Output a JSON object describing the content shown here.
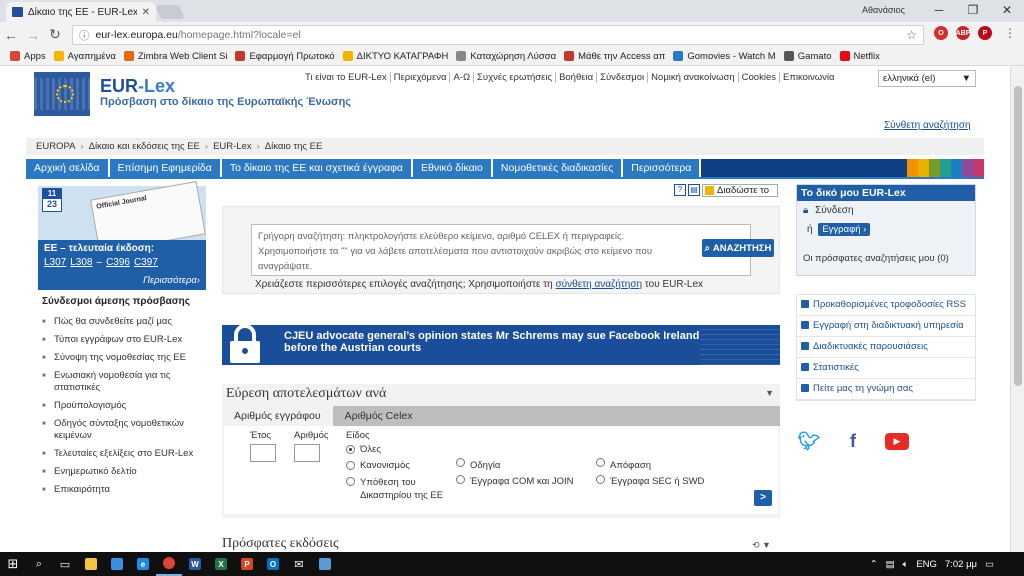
{
  "browser": {
    "tab_title": "Δίκαιο της ΕΕ - EUR-Lex",
    "user": "Αθανάσιος",
    "url_host": "eur-lex.europa.eu",
    "url_path": "/homepage.html?locale=el",
    "bookmarks": [
      {
        "label": "Apps",
        "color": "#d14836"
      },
      {
        "label": "Αγαπημένα",
        "color": "#f5b400"
      },
      {
        "label": "Zimbra Web Client Si",
        "color": "#e36c0a"
      },
      {
        "label": "Εφαρμογή Πρωτοκό",
        "color": "#c0392b"
      },
      {
        "label": "ΔΙΚΤΥΟ ΚΑΤΑΓΡΑΦΗ",
        "color": "#f5b400"
      },
      {
        "label": "Καταχώρηση Λύσσα",
        "color": "#888888"
      },
      {
        "label": "Μάθε την Access απ",
        "color": "#c0392b"
      },
      {
        "label": "Gomovies - Watch M",
        "color": "#2b79c2"
      },
      {
        "label": "Gamato",
        "color": "#555555"
      },
      {
        "label": "Netflix",
        "color": "#e50914"
      }
    ]
  },
  "header": {
    "brand_eur": "EUR",
    "brand_lex": "-Lex",
    "tagline": "Πρόσβαση στο δίκαιο της Ευρωπαϊκής Ένωσης",
    "toplinks": [
      "Τι είναι το EUR-Lex",
      "Περιεχόμενα",
      "Α-Ω",
      "Συχνές ερωτήσεις",
      "Βοήθεια",
      "Σύνδεσμοι",
      "Νομική ανακοίνωση",
      "Cookies",
      "Επικοινωνία"
    ],
    "language": "ελληνικά (el)",
    "advanced_search": "Σύνθετη αναζήτηση"
  },
  "breadcrumb": [
    "EUROPA",
    "Δίκαιο και εκδόσεις της ΕΕ",
    "EUR-Lex",
    "Δίκαιο της ΕΕ"
  ],
  "nav": [
    "Αρχική σελίδα",
    "Επίσημη Εφημερίδα",
    "Το δίκαιο της ΕΕ και σχετικά έγγραφα",
    "Εθνικό δίκαιο",
    "Νομοθετικές διαδικασίες",
    "Περισσότερα"
  ],
  "journal": {
    "month": "11",
    "day": "23",
    "doc_title": "Official Journal",
    "title": "ΕΕ – τελευταία έκδοση:",
    "links": [
      "L307",
      "L308",
      "C396",
      "C397"
    ],
    "more": "Περισσότερα›"
  },
  "quicklinks": {
    "title": "Σύνδεσμοι άμεσης πρόσβασης",
    "items": [
      "Πώς θα συνδεθείτε μαζί μας",
      "Τύποι εγγράφων στο EUR-Lex",
      "Σύνοψη της νομοθεσίας της ΕΕ",
      "Ενωσιακή νομοθεσία για τις στατιστικές",
      "Προϋπολογισμός",
      "Οδηγός σύνταξης νομοθετικών κειμένων",
      "Τελευταίες εξελίξεις στο EUR-Lex",
      "Ενημερωτικό δελτίο",
      "Επικαιρότητα"
    ]
  },
  "share": "Διαδώστε το",
  "search": {
    "placeholder": "Γρήγορη αναζήτηση: πληκτρολογήστε ελεύθερο κείμενο, αριθμό CELEX ή περιγραφείς. Χρησιμοποιήστε τα \"\" για να λάβετε αποτελέσματα που αντιστοιχούν ακριβώς στο κείμενο που αναγράψατε.",
    "button": "ΑΝΑΖΗΤΗΣΗ",
    "hint_before": "Χρειάζεστε περισσότερες επιλογές αναζήτησης; Χρησιμοποιήστε τη ",
    "hint_link": "σύνθετη αναζήτηση",
    "hint_after": " του EUR-Lex"
  },
  "news": {
    "line1": "CJEU advocate general’s opinion states Mr Schrems may sue Facebook Ireland",
    "line2": "before the Austrian courts"
  },
  "results": {
    "title": "Εύρεση αποτελεσμάτων ανά",
    "tabs": [
      "Αριθμός εγγράφου",
      "Αριθμός Celex"
    ],
    "year_label": "Έτος",
    "number_label": "Αριθμός",
    "type_label": "Είδος",
    "options": {
      "all": "Όλες",
      "regulation": "Κανονισμός",
      "directive": "Οδηγία",
      "decision": "Απόφαση",
      "case": "Υπόθεση του Δικαστηρίου της ΕΕ",
      "com": "Έγγραφα COM και JOIN",
      "sec": "Έγγραφα SEC ή SWD"
    },
    "go": ">"
  },
  "recent": {
    "title": "Πρόσφατες εκδόσεις"
  },
  "my_eurlex": {
    "title": "Το δικό μου EUR-Lex",
    "login": "Σύνδεση",
    "or": "ή",
    "register": "Εγγραφή ›",
    "recent_queries": "Οι πρόσφατες αναζητήσεις μου (0)"
  },
  "services": [
    "Προκαθορισμένες τροφοδοσίες RSS",
    "Εγγραφή στη διαδικτυακή υπηρεσία",
    "Διαδικτυακές παρουσιάσεις",
    "Στατιστικές",
    "Πείτε μας τη γνώμη σας"
  ],
  "taskbar": {
    "lang": "ENG",
    "time": "7:02 μμ"
  }
}
